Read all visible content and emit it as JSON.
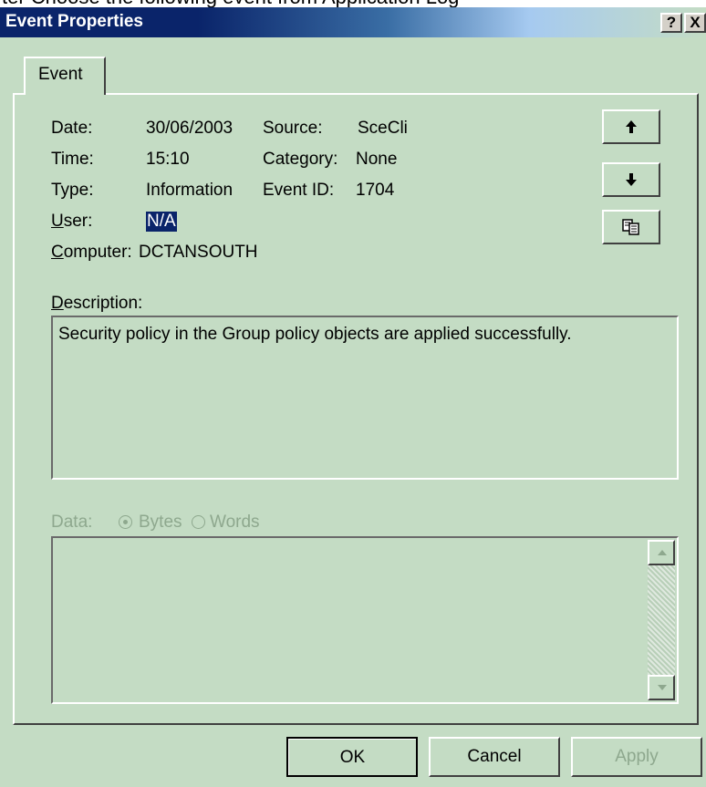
{
  "background_caption": "ter Choose the following event from Application Log",
  "window": {
    "title": "Event Properties",
    "help_glyph": "?",
    "close_glyph": "X"
  },
  "tabs": [
    {
      "label": "Event",
      "active": true
    }
  ],
  "fields": {
    "date_label": "Date:",
    "date_value": "30/06/2003",
    "time_label": "Time:",
    "time_value": "15:10",
    "type_label": "Type:",
    "type_value": "Information",
    "user_label": "User:",
    "user_value": "N/A",
    "computer_label": "Computer:",
    "computer_value": "DCTANSOUTH",
    "source_label": "Source:",
    "source_value": "SceCli",
    "category_label": "Category:",
    "category_value": "None",
    "event_id_label": "Event ID:",
    "event_id_value": "1704"
  },
  "nav_buttons": {
    "up_icon": "arrow-up-icon",
    "down_icon": "arrow-down-icon",
    "copy_icon": "copy-icon"
  },
  "description": {
    "label": "Description:",
    "text": "Security policy in the Group policy objects are applied successfully."
  },
  "data_section": {
    "label": "Data:",
    "options": [
      {
        "label": "Bytes",
        "selected": true
      },
      {
        "label": "Words",
        "selected": false
      }
    ],
    "enabled": false
  },
  "buttons": {
    "ok": "OK",
    "cancel": "Cancel",
    "apply": "Apply"
  },
  "colors": {
    "dialog_bg": "#c4dcc4",
    "title_bar": "#0a246a",
    "selection": "#0a246a",
    "disabled_text": "#8ea88e"
  }
}
